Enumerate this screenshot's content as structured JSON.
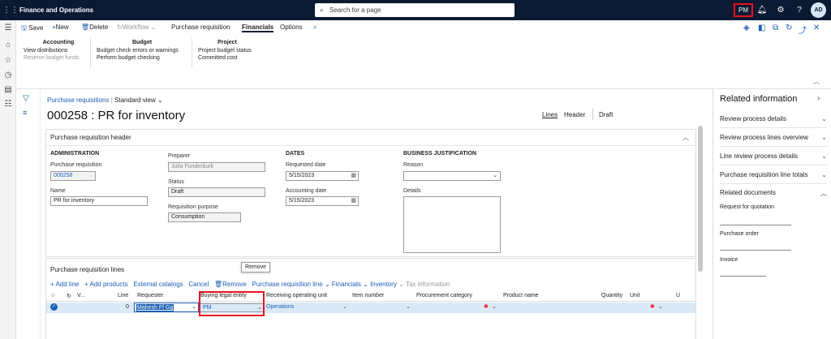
{
  "topbar": {
    "app_title": "Finance and Operations",
    "search_placeholder": "Search for a page",
    "pm_label": "PM",
    "help": "?",
    "avatar": "AD"
  },
  "actions": {
    "save": "Save",
    "new": "New",
    "delete": "Delete",
    "workflow": "Workflow",
    "purchase_requisition": "Purchase requisition",
    "financials": "Financials",
    "options": "Options"
  },
  "groups": {
    "accounting": {
      "header": "Accounting",
      "items": [
        "View distributions",
        "Reserve budget funds"
      ]
    },
    "budget": {
      "header": "Budget",
      "items": [
        "Budget check errors or warnings",
        "Perform budget checking"
      ]
    },
    "project": {
      "header": "Project",
      "items": [
        "Project budget status",
        "Committed cost"
      ]
    }
  },
  "breadcrumb": {
    "link": "Purchase requisitions",
    "view": "Standard view"
  },
  "page": {
    "title": "000258 : PR for inventory",
    "tab_lines": "Lines",
    "tab_header": "Header",
    "status": "Draft"
  },
  "header_section": {
    "title": "Purchase requisition header",
    "administration": {
      "heading": "ADMINISTRATION",
      "pr_label": "Purchase requisition",
      "pr_value": "000258",
      "name_label": "Name",
      "name_value": "PR for inventory"
    },
    "preparer": {
      "label": "Preparer",
      "value": "Julia Funderburk",
      "status_label": "Status",
      "status_value": "Draft",
      "purpose_label": "Requisition purpose",
      "purpose_value": "Consumption"
    },
    "dates": {
      "heading": "DATES",
      "requested_label": "Requested date",
      "requested_value": "5/15/2023",
      "accounting_label": "Accounting date",
      "accounting_value": "5/15/2023"
    },
    "justification": {
      "heading": "BUSINESS JUSTIFICATION",
      "reason_label": "Reason",
      "details_label": "Details"
    }
  },
  "lines_section": {
    "title": "Purchase requisition lines",
    "tooltip": "Remove",
    "toolbar": [
      "+ Add line",
      "+ Add products",
      "External catalogs",
      "Cancel",
      "Remove",
      "Purchase requisition line",
      "Financials",
      "Inventory",
      "Tax information"
    ],
    "columns": [
      "V...",
      "Line",
      "Requester",
      "Buying legal entity",
      "Receiving operating unit",
      "Item number",
      "Procurement category",
      "Product name",
      "Quantity",
      "Unit",
      "U"
    ],
    "row": {
      "line": "0",
      "requester": "Mahesh Ff Gg",
      "legal_entity": "PM",
      "operating_unit": "Operations"
    }
  },
  "related": {
    "title": "Related information",
    "items": [
      "Review process details",
      "Review process lines overview",
      "Line review process details",
      "Purchase requisition line totals"
    ],
    "docs_header": "Related documents",
    "docs": [
      "Request for quotation",
      "Purchase order",
      "Invoice"
    ]
  }
}
